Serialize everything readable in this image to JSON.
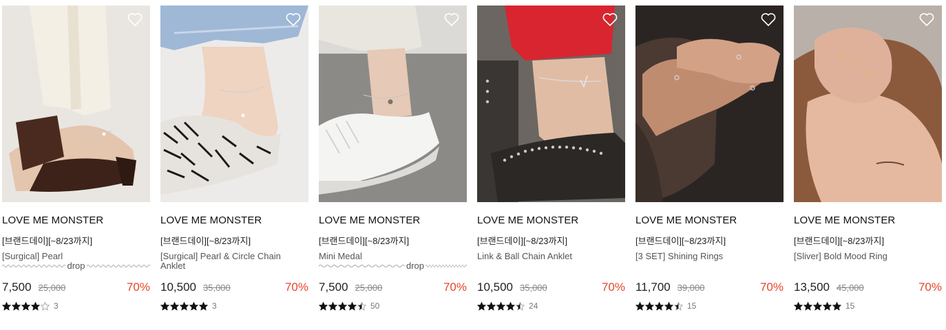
{
  "colors": {
    "discount": "#e8452c",
    "star": "#111111"
  },
  "products": [
    {
      "brand": "LOVE ME MONSTER",
      "promo": "[브랜드데이][~8/23까지]",
      "name_line1": "[Surgical] Pearl",
      "name_line2": "drop",
      "price": "7,500",
      "original_price": "25,000",
      "discount": "70%",
      "rating": 4,
      "reviews": "3",
      "icon": "heart-icon"
    },
    {
      "brand": "LOVE ME MONSTER",
      "promo": "[브랜드데이][~8/23까지]",
      "name_line1": "[Surgical] Pearl & Circle Chain",
      "name_line2": "Anklet",
      "price": "10,500",
      "original_price": "35,000",
      "discount": "70%",
      "rating": 5,
      "reviews": "3",
      "icon": "heart-icon"
    },
    {
      "brand": "LOVE ME MONSTER",
      "promo": "[브랜드데이][~8/23까지]",
      "name_line1": "Mini Medal",
      "name_line2": "drop",
      "price": "7,500",
      "original_price": "25,000",
      "discount": "70%",
      "rating": 4.5,
      "reviews": "50",
      "icon": "heart-icon"
    },
    {
      "brand": "LOVE ME MONSTER",
      "promo": "[브랜드데이][~8/23까지]",
      "name_line1": "Link & Ball Chain Anklet",
      "name_line2": "",
      "price": "10,500",
      "original_price": "35,000",
      "discount": "70%",
      "rating": 4.5,
      "reviews": "24",
      "icon": "heart-icon"
    },
    {
      "brand": "LOVE ME MONSTER",
      "promo": "[브랜드데이][~8/23까지]",
      "name_line1": "[3 SET] Shining Rings",
      "name_line2": "",
      "price": "11,700",
      "original_price": "39,000",
      "discount": "70%",
      "rating": 4.5,
      "reviews": "15",
      "icon": "heart-icon"
    },
    {
      "brand": "LOVE ME MONSTER",
      "promo": "[브랜드데이][~8/23까지]",
      "name_line1": "[Sliver] Bold Mood Ring",
      "name_line2": "",
      "price": "13,500",
      "original_price": "45,000",
      "discount": "70%",
      "rating": 5,
      "reviews": "15",
      "icon": "heart-icon"
    }
  ]
}
